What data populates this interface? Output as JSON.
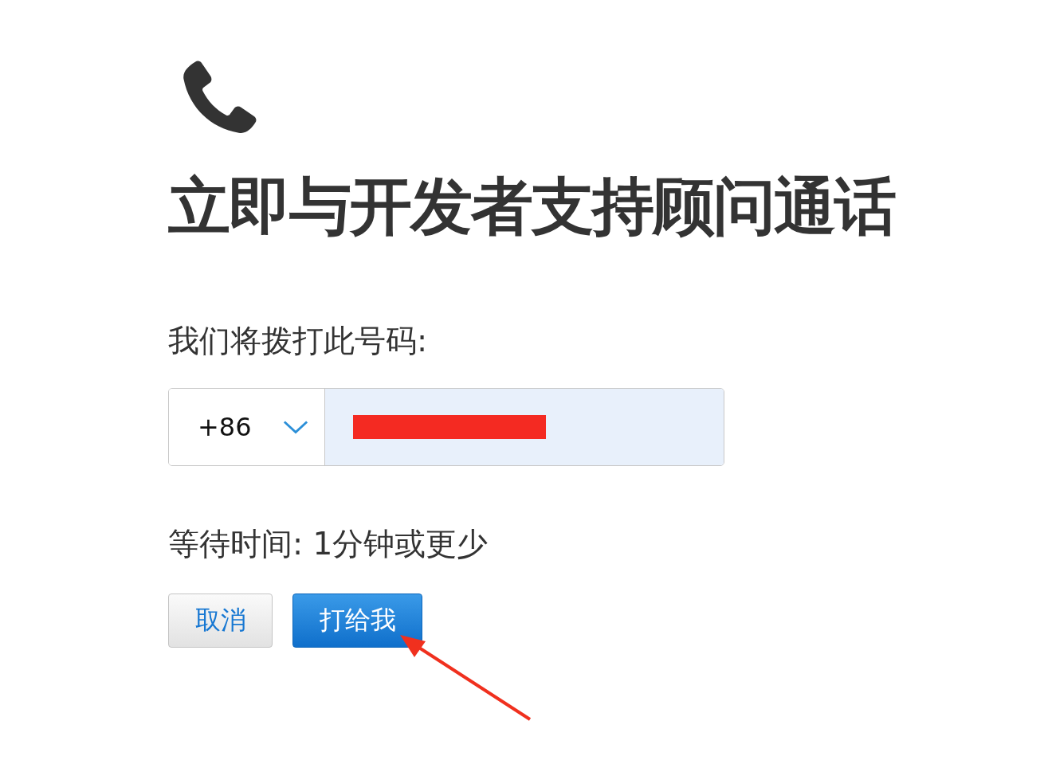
{
  "title": "立即与开发者支持顾问通话",
  "phone_prompt": "我们将拨打此号码:",
  "phone_field": {
    "country_code": "+86",
    "number_redacted": true
  },
  "wait_time": "等待时间: 1分钟或更少",
  "buttons": [
    {
      "label": "取消",
      "kind": "secondary"
    },
    {
      "label": "打给我",
      "kind": "primary"
    }
  ]
}
